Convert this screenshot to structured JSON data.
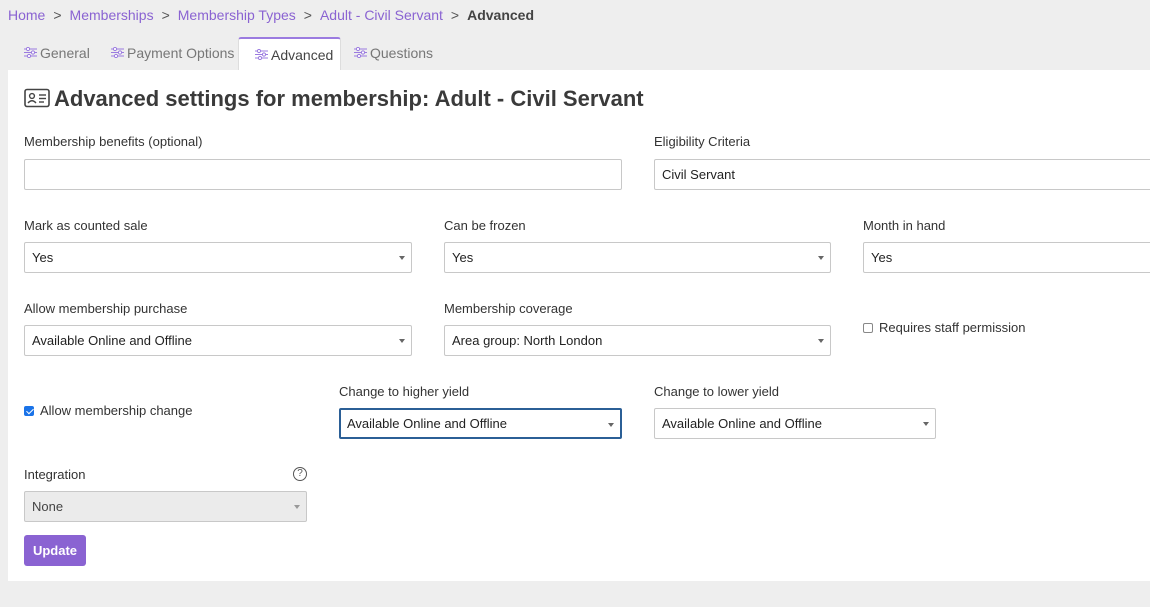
{
  "breadcrumb": {
    "items": [
      "Home",
      "Memberships",
      "Membership Types",
      "Adult - Civil Servant"
    ],
    "current": "Advanced",
    "separator": ">"
  },
  "tabs": [
    {
      "label": "General",
      "icon": "sliders-icon"
    },
    {
      "label": "Payment Options",
      "icon": "sliders-icon"
    },
    {
      "label": "Advanced",
      "icon": "sliders-icon",
      "active": true
    },
    {
      "label": "Questions",
      "icon": "sliders-icon"
    }
  ],
  "page": {
    "title": "Advanced settings for membership: Adult - Civil Servant",
    "title_icon": "id-card-icon"
  },
  "form": {
    "benefits": {
      "label": "Membership benefits (optional)",
      "value": ""
    },
    "eligibility": {
      "label": "Eligibility Criteria",
      "value": "Civil Servant"
    },
    "counted_sale": {
      "label": "Mark as counted sale",
      "value": "Yes"
    },
    "frozen": {
      "label": "Can be frozen",
      "value": "Yes"
    },
    "month_in_hand": {
      "label": "Month in hand",
      "value": "Yes"
    },
    "purchase": {
      "label": "Allow membership purchase",
      "value": "Available Online and Offline"
    },
    "coverage": {
      "label": "Membership coverage",
      "value": "Area group: North London"
    },
    "staff_permission": {
      "label": "Requires staff permission",
      "checked": false
    },
    "allow_change": {
      "label": "Allow membership change",
      "checked": true
    },
    "higher_yield": {
      "label": "Change to higher yield",
      "value": "Available Online and Offline"
    },
    "lower_yield": {
      "label": "Change to lower yield",
      "value": "Available Online and Offline"
    },
    "integration": {
      "label": "Integration",
      "value": "None",
      "help": "?"
    },
    "submit": "Update"
  },
  "colors": {
    "accent": "#8a63d2",
    "focus": "#2b5f96",
    "checkbox": "#1a73e8"
  }
}
